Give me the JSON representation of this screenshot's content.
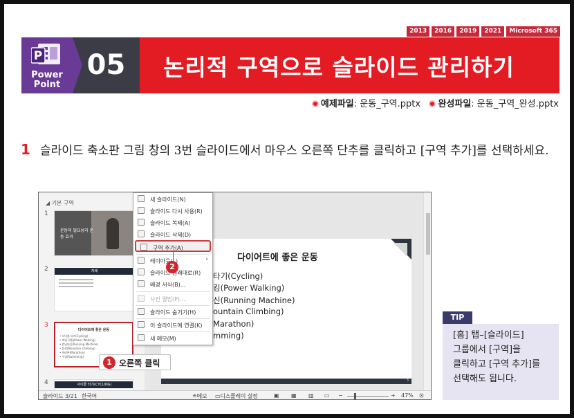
{
  "versions": [
    "2013",
    "2016",
    "2019",
    "2021",
    "Microsoft 365"
  ],
  "banner": {
    "logo_line1": "Power",
    "logo_line2": "Point",
    "number": "05",
    "title": "논리적 구역으로 슬라이드 관리하기"
  },
  "files": {
    "example_label": "예제파일",
    "example_file": ": 운동_구역.pptx",
    "complete_label": "완성파일",
    "complete_file": ": 운동_구역_완성.pptx"
  },
  "step": {
    "number": "1",
    "text": "슬라이드 축소판 그림 창의 3번 슬라이드에서 마우스 오른쪽 단추를 클릭하고 [구역 추가]를 선택하세요."
  },
  "screenshot": {
    "section_label": "◢ 기본 구역",
    "slide_numbers": [
      "1",
      "2",
      "3",
      "4"
    ],
    "thumb1_text": "운동의 필요성과 운동 효과",
    "thumb2_title": "차례",
    "thumb3_title": "다이어트에 좋은 운동",
    "thumb3_lines": [
      "• 사이클 타기(Cycling)",
      "• 파워 워킹(Power Walking)",
      "• 런닝머신(Running Machine)",
      "• 등산(Mountain Climbing)",
      "• 마라톤(Marathon)",
      "• 수영(Swimming)"
    ],
    "thumb4_title": "사이클 타기(CYCLING)",
    "slide_title": "다이어트에 좋은 운동",
    "slide_lines": [
      "타기(Cycling)",
      "킹(Power Walking)",
      "신(Running Machine)",
      "ountain Climbing)",
      "Marathon)",
      "mming)"
    ],
    "slide_page": "3",
    "status_left": "슬라이드 3/21",
    "status_lang": "한국어",
    "status_notes": "≗메모",
    "status_display": "디스플레이 설정",
    "status_zoom": "47%"
  },
  "context_menu": {
    "items": [
      {
        "label": "새 슬라이드(N)"
      },
      {
        "label": "슬라이드 다시 사용(R)"
      },
      {
        "label": "슬라이드 복제(A)"
      },
      {
        "label": "슬라이드 삭제(D)"
      },
      {
        "label": "구역 추가(A)"
      },
      {
        "label": "레이아웃(L)"
      },
      {
        "label": "슬라이드 원래대로(R)"
      },
      {
        "label": "배경 서식(B)..."
      },
      {
        "label": "사진 앨범(P)..."
      },
      {
        "label": "슬라이드 숨기기(H)"
      },
      {
        "label": "이 슬라이드에 연결(K)"
      },
      {
        "label": "새 메모(M)"
      }
    ]
  },
  "callouts": {
    "badge1": "1",
    "label1": "오른쪽 클릭",
    "badge2": "2"
  },
  "tip": {
    "tag": "TIP",
    "text": "[홈] 탭–[슬라이드] 그룹에서 [구역]을 클릭하고 [구역 추가]를 선택해도 됩니다."
  },
  "colors": {
    "banner_red": "#e31b23",
    "powerpoint_purple": "#6a3a97",
    "number_dark": "#3c3c46",
    "tip_navy": "#3b3b6b",
    "tip_bg": "#e6e4f2"
  }
}
